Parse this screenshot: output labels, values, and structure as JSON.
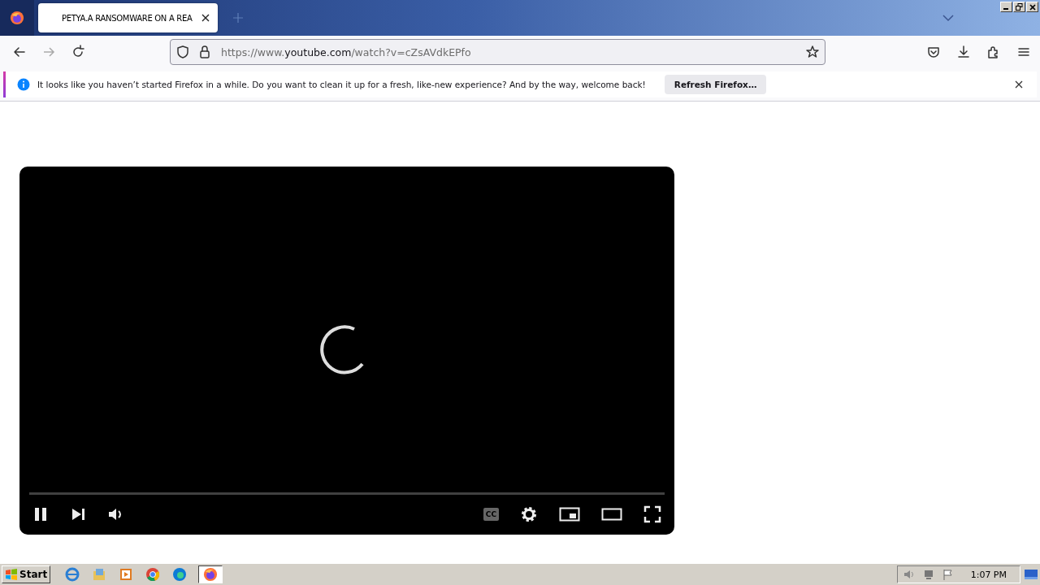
{
  "browser": {
    "tab": {
      "title": "PETYA.A RANSOMWARE ON A REA",
      "selected": true
    },
    "url": {
      "scheme": "https://www.",
      "host": "youtube.com",
      "path": "/watch?v=cZsAVdkEPfo"
    },
    "notification": {
      "message": "It looks like you haven’t started Firefox in a while. Do you want to clean it up for a fresh, like-new experience? And by the way, welcome back!",
      "button": "Refresh Firefox…"
    }
  },
  "video_player": {
    "loading": true,
    "playing": true,
    "cc_label": "CC"
  },
  "taskbar": {
    "start": "Start",
    "tasks": [
      {
        "kind": "firefox",
        "selected": true
      }
    ],
    "clock": "1:07 PM"
  }
}
